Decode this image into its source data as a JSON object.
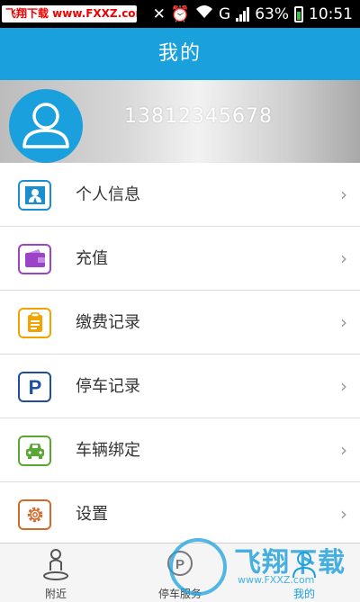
{
  "status_bar": {
    "watermark": "飞翔下载 www.FXXZ.com",
    "battery": "63%",
    "network": "G",
    "time": "10:51"
  },
  "title": "我的",
  "profile": {
    "phone": "13812345678",
    "avatar_icon": "user-avatar-icon"
  },
  "menu": {
    "items": [
      {
        "label": "个人信息",
        "icon": "id-card-icon",
        "color": "#1a8fd0"
      },
      {
        "label": "充值",
        "icon": "wallet-icon",
        "color": "#9b44c8"
      },
      {
        "label": "缴费记录",
        "icon": "clipboard-icon",
        "color": "#f2a300"
      },
      {
        "label": "停车记录",
        "icon": "parking-icon",
        "color": "#1f4ea0"
      },
      {
        "label": "车辆绑定",
        "icon": "car-icon",
        "color": "#5aa834"
      },
      {
        "label": "设置",
        "icon": "gear-icon",
        "color": "#d26a2c"
      }
    ]
  },
  "bottom_nav": {
    "items": [
      {
        "label": "附近",
        "icon": "location-person-icon"
      },
      {
        "label": "停车服务",
        "icon": "parking-service-icon"
      },
      {
        "label": "我的",
        "icon": "user-icon",
        "active": true
      }
    ]
  },
  "watermark": {
    "text": "飞翔下载",
    "url": "www.FXXZ.com"
  },
  "colors": {
    "accent": "#1aa0dc",
    "menu_text": "#333333",
    "divider": "#dcdcdc"
  }
}
